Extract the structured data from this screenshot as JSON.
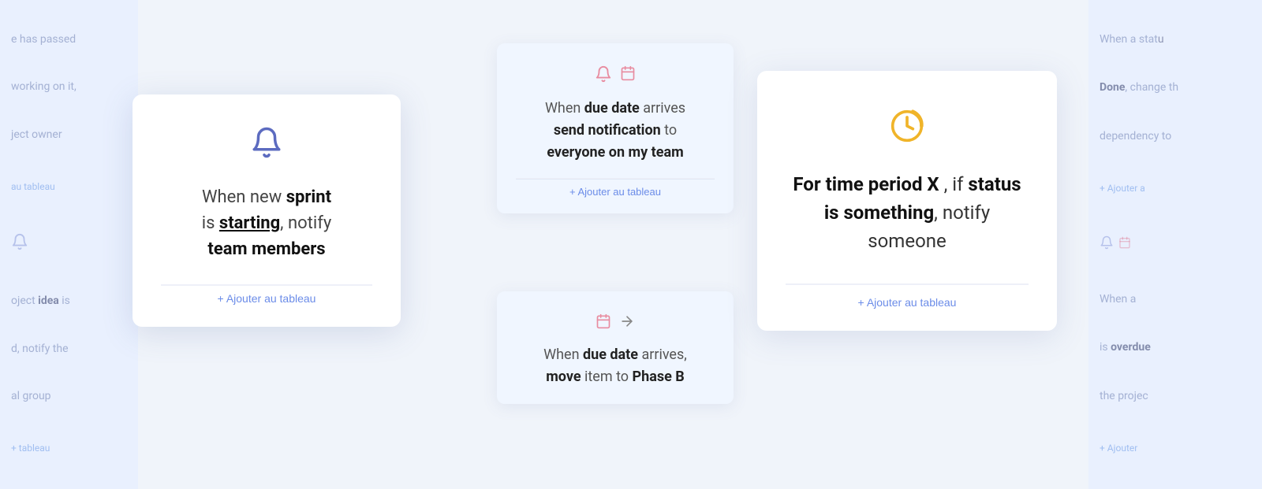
{
  "background": {
    "left_col": {
      "items": [
        {
          "text_parts": [
            "e has passed"
          ],
          "bold": ""
        },
        {
          "text_parts": [
            "working on it,"
          ],
          "bold": ""
        },
        {
          "text_parts": [
            "ject owner"
          ],
          "bold": ""
        },
        {
          "link": "au tableau"
        },
        {
          "bell": true
        },
        {
          "text_parts": [
            "oject ",
            "idea",
            " is"
          ]
        },
        {
          "text_parts": [
            "d, notify the"
          ]
        },
        {
          "text_parts": [
            "al group"
          ]
        },
        {
          "link": "tableau"
        }
      ]
    },
    "right_col": {
      "items": [
        {
          "text_parts": [
            "When a stat"
          ]
        },
        {
          "text_parts": [
            "Done",
            ", change th"
          ]
        },
        {
          "text_parts": [
            "dependency to"
          ]
        },
        {
          "link": "Ajouter a"
        },
        {
          "bell": true
        },
        {
          "text_parts": [
            "When a"
          ]
        },
        {
          "text_parts": [
            "is ",
            "overdue"
          ]
        },
        {
          "text_parts": [
            "the projec"
          ]
        },
        {
          "link": "Ajouter"
        }
      ]
    }
  },
  "cards": {
    "sprint": {
      "bell_icon": "🔔",
      "text_line1": "When new ",
      "text_bold1": "sprint",
      "text_line2": "is ",
      "text_bold_underline": "starting",
      "text_line3": ", notify",
      "text_bold2": "team members",
      "add_button": "+ Ajouter au tableau"
    },
    "due_notify": {
      "icon1_type": "bell",
      "icon2_type": "calendar",
      "text_when": "When ",
      "text_bold1": "due date",
      "text_line1": " arrives",
      "text_bold2": "send notification",
      "text_line2": " to",
      "text_bold3": "everyone on my team",
      "add_button": "+ Ajouter au tableau"
    },
    "due_move": {
      "icon1_type": "calendar",
      "icon2_type": "arrow",
      "text_when": "When ",
      "text_bold1": "due date",
      "text_line1": " arrives,",
      "text_bold2": "move",
      "text_line2": " item to ",
      "text_bold3": "Phase B"
    },
    "time_period": {
      "clock_icon": "🕐",
      "text_bold1": "For time period X",
      "text_line1": " , if ",
      "text_bold2": "status is something",
      "text_line2": ", notify someone",
      "add_button": "+ Ajouter au tableau"
    }
  }
}
